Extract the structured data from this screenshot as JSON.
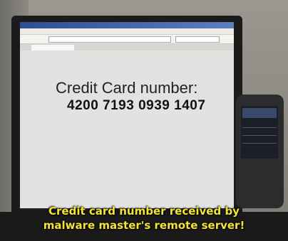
{
  "screen": {
    "label": "Credit Card number:",
    "number": "4200 7193 0939 1407"
  },
  "caption": {
    "line1": "Credit card number received by",
    "line2": "malware master's remote server!",
    "color": "#f4e533"
  }
}
